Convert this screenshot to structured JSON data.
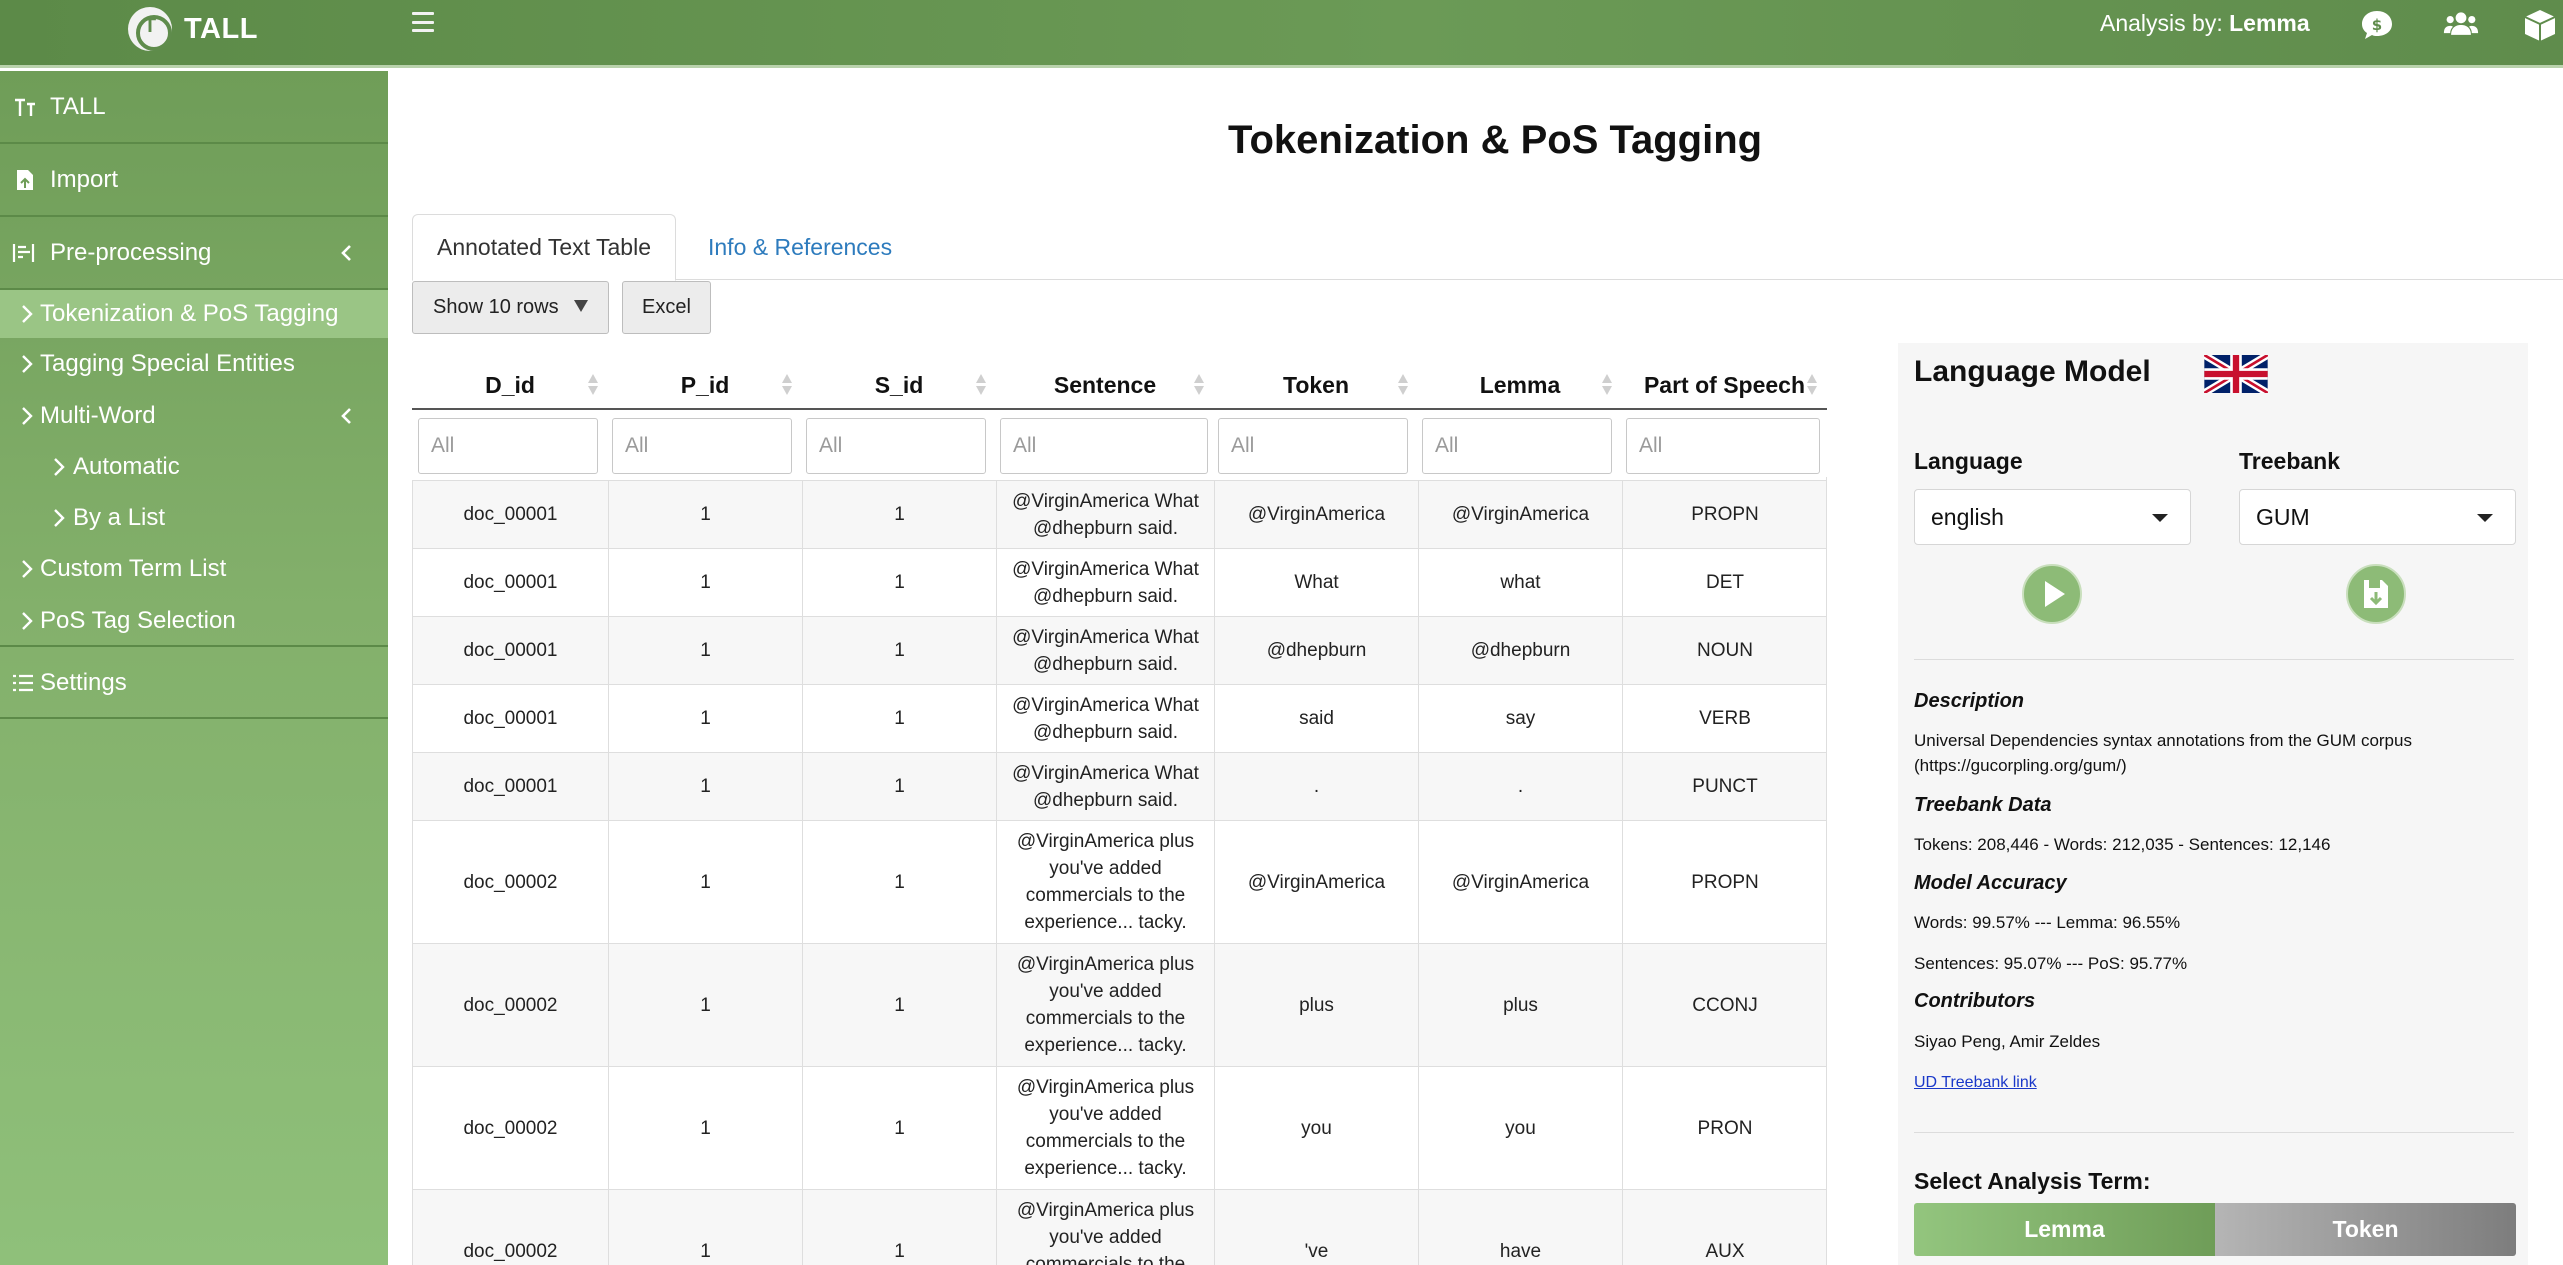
{
  "header": {
    "brand": "TALL",
    "analysis_prefix": "Analysis by: ",
    "analysis_value": "Lemma"
  },
  "sidebar": {
    "items": [
      {
        "label": "TALL",
        "icon": "tall-icon"
      },
      {
        "label": "Import",
        "icon": "import-icon"
      },
      {
        "label": "Pre-processing",
        "icon": "preprocessing-icon"
      },
      {
        "label": "Tokenization & PoS Tagging"
      },
      {
        "label": "Tagging Special Entities"
      },
      {
        "label": "Multi-Word"
      },
      {
        "label": "Automatic"
      },
      {
        "label": "By a List"
      },
      {
        "label": "Custom Term List"
      },
      {
        "label": "PoS Tag Selection"
      },
      {
        "label": "Settings",
        "icon": "settings-icon"
      }
    ],
    "active_item": "Tokenization & PoS Tagging"
  },
  "main": {
    "title": "Tokenization & PoS Tagging",
    "tabs": [
      {
        "label": "Annotated Text Table",
        "active": true
      },
      {
        "label": "Info & References",
        "active": false
      }
    ],
    "show_rows_label": "Show 10 rows",
    "excel_label": "Excel"
  },
  "table": {
    "columns": [
      "D_id",
      "P_id",
      "S_id",
      "Sentence",
      "Token",
      "Lemma",
      "Part of Speech"
    ],
    "filter_placeholder": "All",
    "rows": [
      [
        "doc_00001",
        "1",
        "1",
        "@VirginAmerica What @dhepburn said.",
        "@VirginAmerica",
        "@VirginAmerica",
        "PROPN"
      ],
      [
        "doc_00001",
        "1",
        "1",
        "@VirginAmerica What @dhepburn said.",
        "What",
        "what",
        "DET"
      ],
      [
        "doc_00001",
        "1",
        "1",
        "@VirginAmerica What @dhepburn said.",
        "@dhepburn",
        "@dhepburn",
        "NOUN"
      ],
      [
        "doc_00001",
        "1",
        "1",
        "@VirginAmerica What @dhepburn said.",
        "said",
        "say",
        "VERB"
      ],
      [
        "doc_00001",
        "1",
        "1",
        "@VirginAmerica What @dhepburn said.",
        ".",
        ".",
        "PUNCT"
      ],
      [
        "doc_00002",
        "1",
        "1",
        "@VirginAmerica plus you've added commercials to the experience... tacky.",
        "@VirginAmerica",
        "@VirginAmerica",
        "PROPN"
      ],
      [
        "doc_00002",
        "1",
        "1",
        "@VirginAmerica plus you've added commercials to the experience... tacky.",
        "plus",
        "plus",
        "CCONJ"
      ],
      [
        "doc_00002",
        "1",
        "1",
        "@VirginAmerica plus you've added commercials to the experience... tacky.",
        "you",
        "you",
        "PRON"
      ],
      [
        "doc_00002",
        "1",
        "1",
        "@VirginAmerica plus you've added commercials to the experience... tacky.",
        "'ve",
        "have",
        "AUX"
      ]
    ]
  },
  "panel": {
    "title": "Language Model",
    "flag_icon": "uk-flag-icon",
    "language_label": "Language",
    "language_value": "english",
    "treebank_label": "Treebank",
    "treebank_value": "GUM",
    "description_head": "Description",
    "description_text": "Universal Dependencies syntax annotations from the GUM corpus (https://gucorpling.org/gum/)",
    "treebank_data_head": "Treebank Data",
    "treebank_data_text": "Tokens: 208,446 - Words: 212,035 - Sentences: 12,146",
    "accuracy_head": "Model Accuracy",
    "accuracy_line1": "Words: 99.57% --- Lemma: 96.55%",
    "accuracy_line2": "Sentences: 95.07% --- PoS: 95.77%",
    "contributors_head": "Contributors",
    "contributors_text": "Siyao Peng, Amir Zeldes",
    "link_text": "UD Treebank link",
    "select_term_label": "Select Analysis Term:",
    "term_lemma": "Lemma",
    "term_token": "Token"
  }
}
